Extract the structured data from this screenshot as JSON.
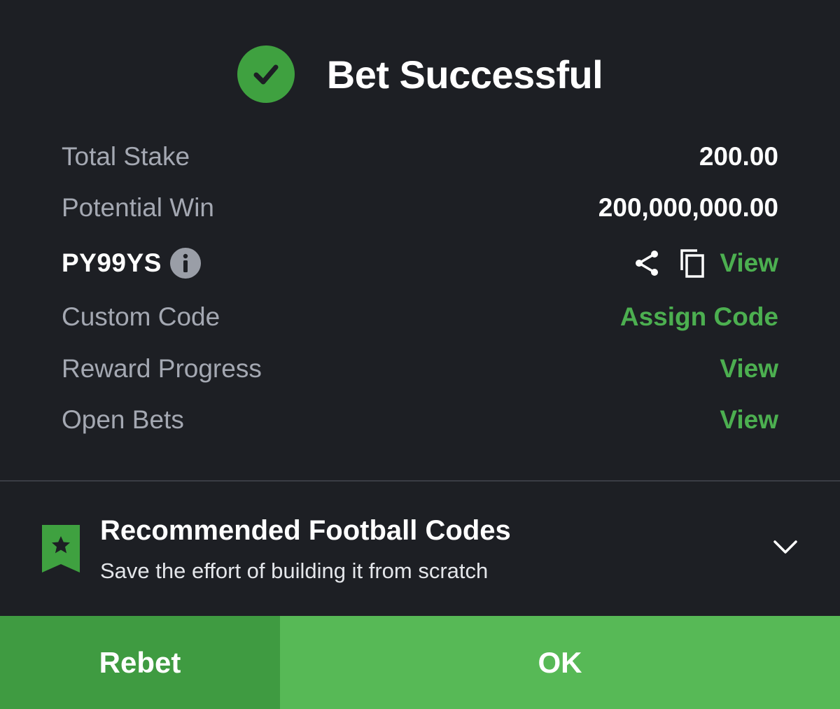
{
  "header": {
    "title": "Bet Successful",
    "icon": "check-circle-icon",
    "accent_color": "#3fa140"
  },
  "summary": {
    "total_stake_label": "Total Stake",
    "total_stake_value": "200.00",
    "potential_win_label": "Potential Win",
    "potential_win_value": "200,000,000.00",
    "booking_code": "PY99YS",
    "booking_code_view": "View",
    "custom_code_label": "Custom Code",
    "custom_code_action": "Assign Code",
    "reward_progress_label": "Reward Progress",
    "reward_progress_action": "View",
    "open_bets_label": "Open Bets",
    "open_bets_action": "View"
  },
  "recommended": {
    "title": "Recommended Football Codes",
    "subtitle": "Save the effort of building it from scratch"
  },
  "footer": {
    "rebet_label": "Rebet",
    "ok_label": "OK"
  },
  "colors": {
    "background": "#1d1f24",
    "link_green": "#4caf50",
    "rebet_bg": "#3f9b41",
    "ok_bg": "#57b956"
  }
}
